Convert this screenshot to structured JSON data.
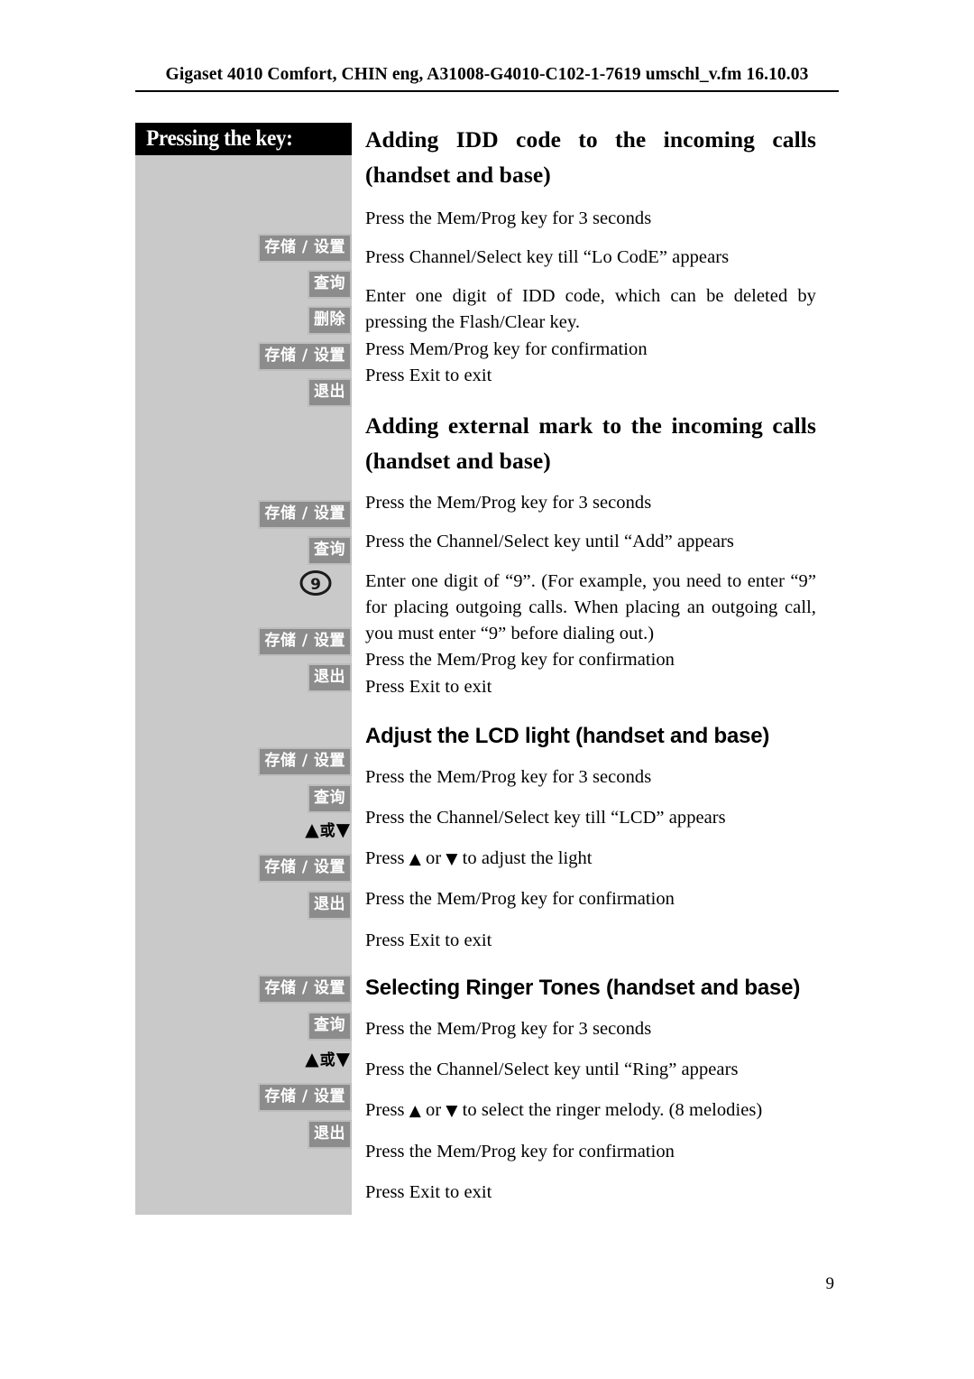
{
  "header": {
    "running_head": "Gigaset 4010 Comfort, CHIN eng, A31008-G4010-C102-1-7619 umschl_v.fm 16.10.03"
  },
  "key_panel": {
    "banner_label": "Pressing the key:",
    "colors": {
      "panel_background": "#c9c9c9",
      "banner_background": "#000000",
      "chip_fill": "#8c8c8c",
      "chip_border": "#bdbdbd",
      "chip_text": "#ffffff"
    },
    "keys": [
      {
        "id": "store-set-1",
        "label": "存储 / 设置",
        "type": "chip"
      },
      {
        "id": "query-1",
        "label": "查询",
        "type": "chip"
      },
      {
        "id": "delete-1",
        "label": "删除",
        "type": "chip"
      },
      {
        "id": "store-set-2",
        "label": "存储 / 设置",
        "type": "chip"
      },
      {
        "id": "exit-1",
        "label": "退出",
        "type": "chip"
      },
      {
        "id": "store-set-3",
        "label": "存储 / 设置",
        "type": "chip"
      },
      {
        "id": "query-2",
        "label": "查询",
        "type": "chip"
      },
      {
        "id": "digit-nine",
        "label": "9",
        "type": "digit-key"
      },
      {
        "id": "store-set-4",
        "label": "存储 / 设置",
        "type": "chip"
      },
      {
        "id": "exit-2",
        "label": "退出",
        "type": "chip"
      },
      {
        "id": "store-set-5",
        "label": "存储 / 设置",
        "type": "chip"
      },
      {
        "id": "query-3",
        "label": "查询",
        "type": "chip"
      },
      {
        "id": "updown-1",
        "up": "▲",
        "or": "或",
        "down": "▼",
        "type": "arrows"
      },
      {
        "id": "store-set-6",
        "label": "存储 / 设置",
        "type": "chip"
      },
      {
        "id": "exit-3",
        "label": "退出",
        "type": "chip"
      },
      {
        "id": "store-set-7",
        "label": "存储 / 设置",
        "type": "chip"
      },
      {
        "id": "query-4",
        "label": "查询",
        "type": "chip"
      },
      {
        "id": "updown-2",
        "up": "▲",
        "or": "或",
        "down": "▼",
        "type": "arrows"
      },
      {
        "id": "store-set-8",
        "label": "存储 / 设置",
        "type": "chip"
      },
      {
        "id": "exit-4",
        "label": "退出",
        "type": "chip"
      }
    ]
  },
  "sections": [
    {
      "title_line1": "Adding IDD code to the incoming calls",
      "title_line2": "(handset and base)",
      "steps": [
        "Press the Mem/Prog key for 3 seconds",
        "Press Channel/Select key till “Lo CodE” appears",
        "Enter one digit of IDD code, which can be deleted by pressing the Flash/Clear key.",
        "Press Mem/Prog key for confirmation",
        "Press Exit to exit"
      ]
    },
    {
      "title_line1": "Adding external mark to the incoming calls",
      "title_line2": "(handset and base)",
      "steps": [
        "Press the Mem/Prog key for 3 seconds",
        "Press the Channel/Select key until “Add” appears",
        "Enter one digit of “9”. (For example, you need to enter “9” for placing outgoing calls. When placing an outgoing call, you must enter “9” before dialing out.)",
        "Press the Mem/Prog key for confirmation",
        "Press Exit to exit"
      ]
    },
    {
      "title_line1": "Adjust the LCD light (handset and base)",
      "steps": [
        "Press the Mem/Prog key for 3 seconds",
        "Press the Channel/Select key till “LCD” appears",
        {
          "prefix": "Press ",
          "up": "▲",
          "mid": " or ",
          "down": "▼",
          "suffix": " to adjust the light"
        },
        "Press the Mem/Prog key for confirmation",
        "Press Exit to exit"
      ]
    },
    {
      "title_line1": "Selecting Ringer Tones (handset and base)",
      "steps": [
        "Press the Mem/Prog key for 3 seconds",
        "Press the Channel/Select key until “Ring” appears",
        {
          "prefix": "Press ",
          "up": "▲",
          "mid": " or ",
          "down": "▼",
          "suffix": " to select the ringer melody. (8 melodies)"
        },
        "Press the Mem/Prog key for confirmation",
        "Press Exit to exit"
      ]
    }
  ],
  "footer": {
    "page_number": "9"
  }
}
